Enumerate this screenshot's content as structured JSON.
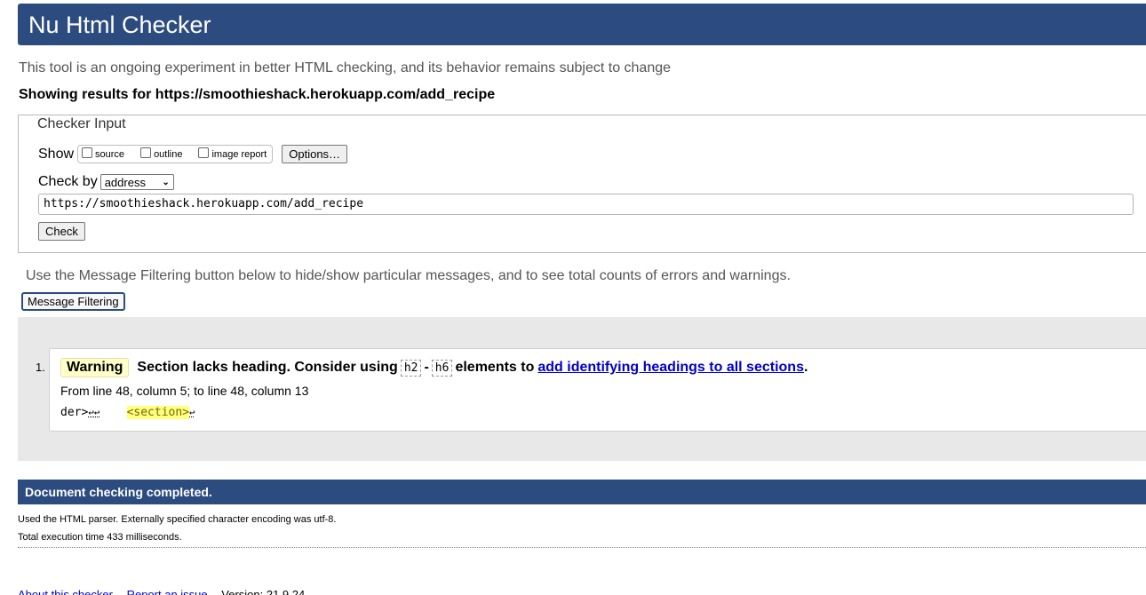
{
  "header": {
    "title": "Nu Html Checker"
  },
  "tagline": "This tool is an ongoing experiment in better HTML checking, and its behavior remains subject to change",
  "showing": {
    "prefix": "Showing results for ",
    "url": "https://smoothieshack.herokuapp.com/add_recipe"
  },
  "checker_input": {
    "legend": "Checker Input",
    "show_label": "Show",
    "options": [
      {
        "label": "source",
        "checked": false
      },
      {
        "label": "outline",
        "checked": false
      },
      {
        "label": "image report",
        "checked": false
      }
    ],
    "options_button": "Options…",
    "check_by_label": "Check by",
    "check_by_value": "address",
    "url_value": "https://smoothieshack.herokuapp.com/add_recipe",
    "check_button": "Check"
  },
  "filter": {
    "note": "Use the Message Filtering button below to hide/show particular messages, and to see total counts of errors and warnings.",
    "button": "Message Filtering"
  },
  "messages": [
    {
      "number": "1.",
      "type": "Warning",
      "text_before": "Section lacks heading. Consider using",
      "code1": "h2",
      "separator": "-",
      "code2": "h6",
      "text_after": "elements to",
      "link_text": "add identifying headings to all sections",
      "end_punct": ".",
      "location": "From line 48, column 5; to line 48, column 13",
      "extract_prefix": "der>",
      "extract_newlines": "↩↩",
      "extract_highlight": "<section>",
      "extract_suffix": "↩"
    }
  ],
  "completion": {
    "title": "Document checking completed.",
    "line1": "Used the HTML parser. Externally specified character encoding was utf-8.",
    "line2": "Total execution time 433 milliseconds."
  },
  "footer": {
    "links": [
      "About this checker",
      "Report an issue",
      "Version: 21.9.24"
    ]
  },
  "colors": {
    "brand": "#2c4c80",
    "warning_bg": "#ffffc8",
    "link": "#0000cc"
  }
}
